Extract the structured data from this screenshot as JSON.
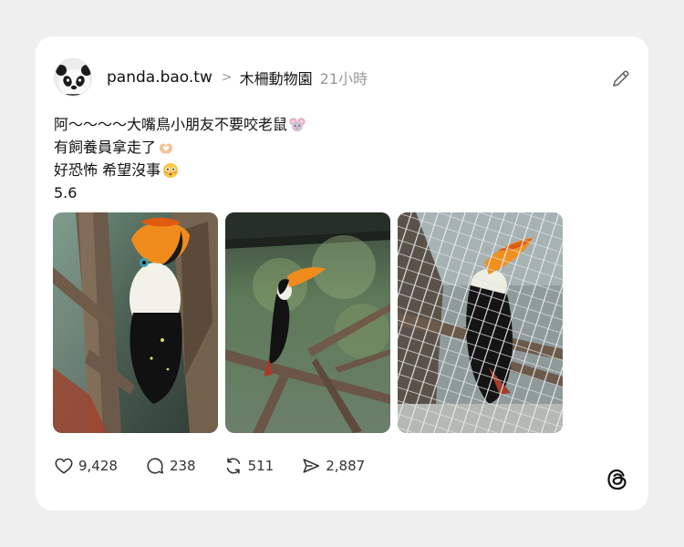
{
  "post": {
    "username": "panda.bao.tw",
    "separator": ">",
    "group": "木柵動物園",
    "time": "21小時",
    "content_lines": [
      "阿～～～～大嘴鳥小朋友不要咬老鼠",
      "有飼養員拿走了",
      "好恐怖 希望沒事",
      "5.6"
    ]
  },
  "icons": {
    "avatar": "panda-face",
    "edit": "pencil-icon",
    "emoji_line1": "mouse-face-emoji",
    "emoji_line2": "heart-hands-emoji",
    "emoji_line3": "flushed-face-emoji",
    "like": "heart-icon",
    "reply": "comment-bubble-icon",
    "repost": "repost-icon",
    "share": "send-icon",
    "brand": "threads-logo"
  },
  "photos": [
    {
      "alt": "toucan-closeup"
    },
    {
      "alt": "toucan-on-branch"
    },
    {
      "alt": "toucan-behind-cage"
    }
  ],
  "stats": {
    "likes": "9,428",
    "replies": "238",
    "reposts": "511",
    "shares": "2,887"
  },
  "colors": {
    "background": "#efefef",
    "card": "#ffffff",
    "text": "#111111",
    "muted": "#999999"
  }
}
